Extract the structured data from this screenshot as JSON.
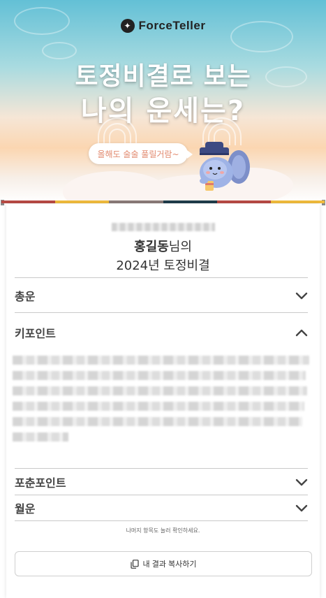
{
  "brand": {
    "name": "ForceTeller",
    "mark": "✦"
  },
  "hero": {
    "headline_line1": "토정비결로 보는",
    "headline_line2": "나의 운세는?",
    "speech_bubble": "올해도 술술 풀릴거람~"
  },
  "profile": {
    "birth_info_redacted": "",
    "name": "홍길동",
    "name_suffix": "님의",
    "subtitle": "2024년 토정비결"
  },
  "sections": [
    {
      "title": "총운",
      "state": "collapsed"
    },
    {
      "title": "키포인트",
      "state": "expanded"
    },
    {
      "title": "포춘포인트",
      "state": "collapsed"
    },
    {
      "title": "월운",
      "state": "collapsed"
    }
  ],
  "hint_text": "나머지 항목도 눌러 확인하세요.",
  "copy_button_label": "내 결과 복사하기",
  "colors": {
    "stripe": [
      "#b84a44",
      "#f0bb3c",
      "#8a7a78",
      "#1f3c4a",
      "#b84a44",
      "#f0bb3c"
    ],
    "heading": "#444444",
    "bubble_text": "#e28a6f"
  }
}
